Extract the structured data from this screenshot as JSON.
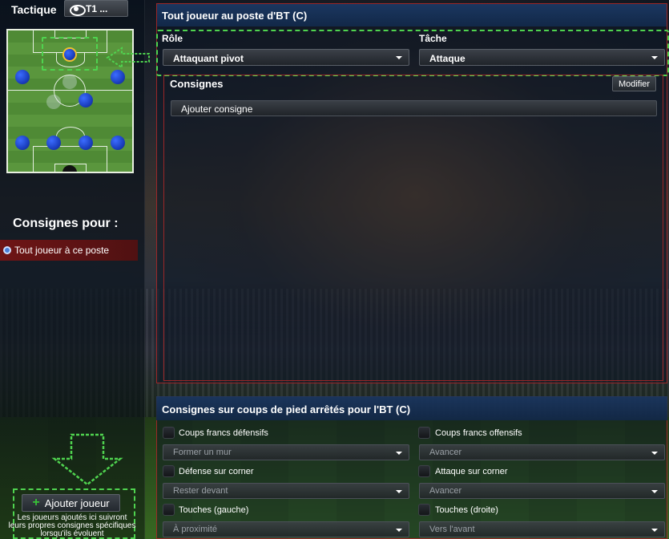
{
  "left": {
    "tactic_label": "Tactique",
    "tactic_selector": "T1 ...",
    "for_label": "Consignes pour :",
    "player_item": "Tout joueur à ce poste",
    "add_player_label": "Ajouter joueur",
    "add_player_help": "Les joueurs ajoutés ici suivront leurs propres consignes spécifiques lorsqu'ils évoluent"
  },
  "main": {
    "title": "Tout joueur au poste d'BT (C)",
    "role_label": "Rôle",
    "role_value": "Attaquant pivot",
    "task_label": "Tâche",
    "task_value": "Attaque",
    "instructions_title": "Consignes",
    "modify_label": "Modifier",
    "add_instruction_label": "Ajouter consigne"
  },
  "setpieces": {
    "title": "Consignes sur coups de pied arrêtés pour l'BT (C)",
    "items": [
      {
        "label": "Coups francs défensifs",
        "value": "Former un mur"
      },
      {
        "label": "Coups francs offensifs",
        "value": "Avancer"
      },
      {
        "label": "Défense sur corner",
        "value": "Rester devant"
      },
      {
        "label": "Attaque sur corner",
        "value": "Avancer"
      },
      {
        "label": "Touches (gauche)",
        "value": "À proximité"
      },
      {
        "label": "Touches (droite)",
        "value": "Vers l'avant"
      }
    ]
  },
  "colors": {
    "accent_highlight": "#4fd34f",
    "panel_border": "#aa2828",
    "player_dot": "#1b3fbf",
    "selected_player_ring": "#f0c030"
  }
}
